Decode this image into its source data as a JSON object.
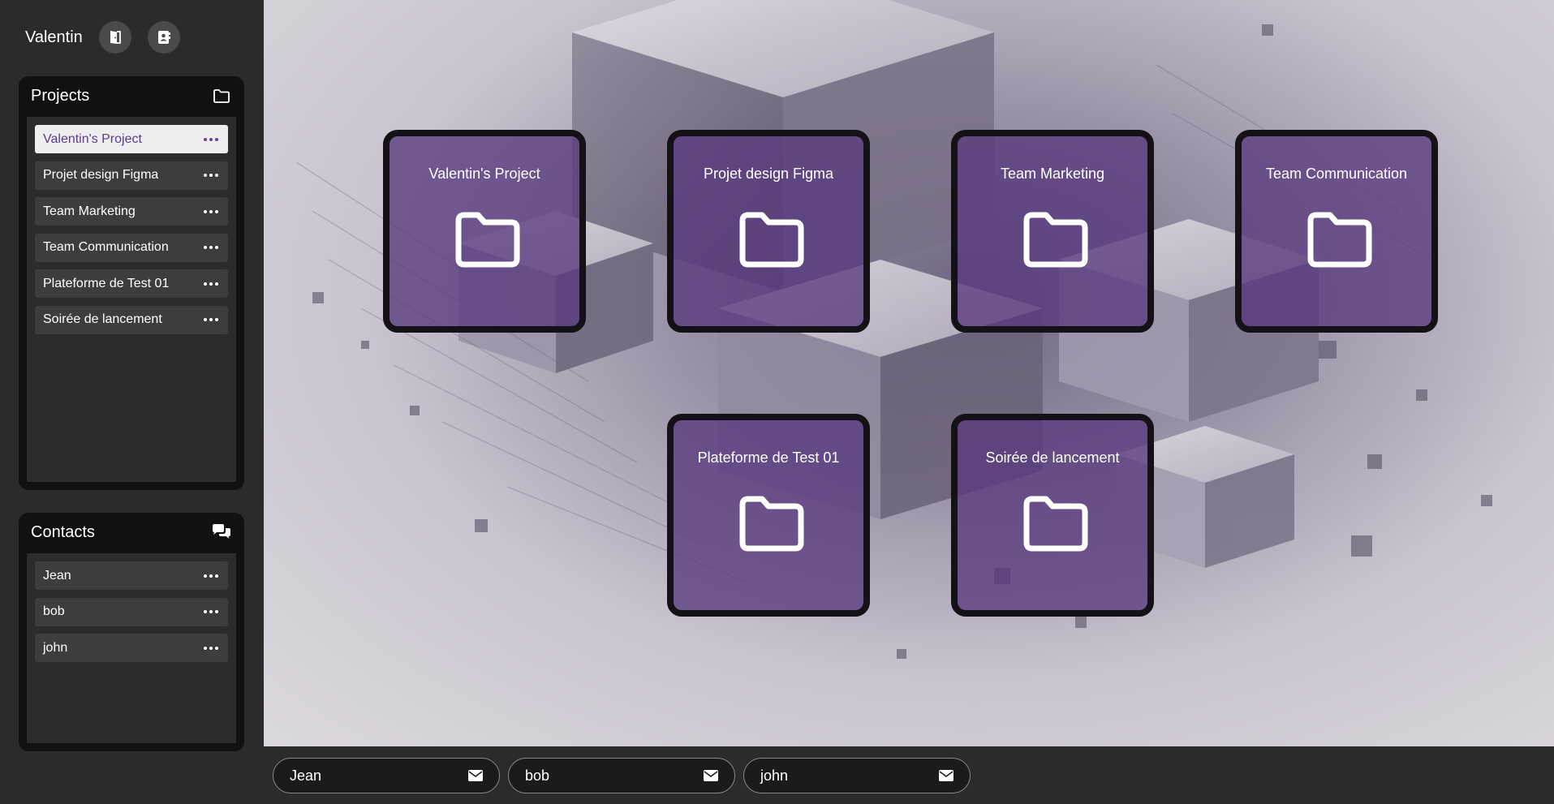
{
  "user": {
    "name": "Valentin"
  },
  "header_buttons": [
    {
      "icon": "door-exit-icon"
    },
    {
      "icon": "contact-book-icon"
    }
  ],
  "projects_panel": {
    "title": "Projects",
    "icon": "folder-outline-icon",
    "items": [
      {
        "label": "Valentin's Project",
        "active": true
      },
      {
        "label": "Projet design Figma"
      },
      {
        "label": "Team Marketing"
      },
      {
        "label": "Team Communication"
      },
      {
        "label": "Plateforme de Test 01"
      },
      {
        "label": "Soirée de lancement"
      }
    ]
  },
  "contacts_panel": {
    "title": "Contacts",
    "icon": "chat-bubbles-icon",
    "items": [
      {
        "label": "Jean"
      },
      {
        "label": "bob"
      },
      {
        "label": "john"
      }
    ]
  },
  "project_cards": [
    {
      "title": "Valentin's Project",
      "icon": "folder-icon"
    },
    {
      "title": "Projet design Figma",
      "icon": "folder-icon"
    },
    {
      "title": "Team Marketing",
      "icon": "folder-icon"
    },
    {
      "title": "Team Communication",
      "icon": "folder-icon"
    },
    {
      "title": "Plateforme de Test 01",
      "icon": "folder-icon"
    },
    {
      "title": "Soirée de lancement",
      "icon": "folder-icon"
    }
  ],
  "chat_chips": [
    {
      "label": "Jean",
      "icon": "envelope-icon"
    },
    {
      "label": "bob",
      "icon": "envelope-icon"
    },
    {
      "label": "john",
      "icon": "envelope-icon"
    }
  ],
  "colors": {
    "accent": "#5e3a8a",
    "card_fill": "#583a7d",
    "sidebar_bg": "#2b2b2b",
    "panel_bg": "#111111"
  }
}
